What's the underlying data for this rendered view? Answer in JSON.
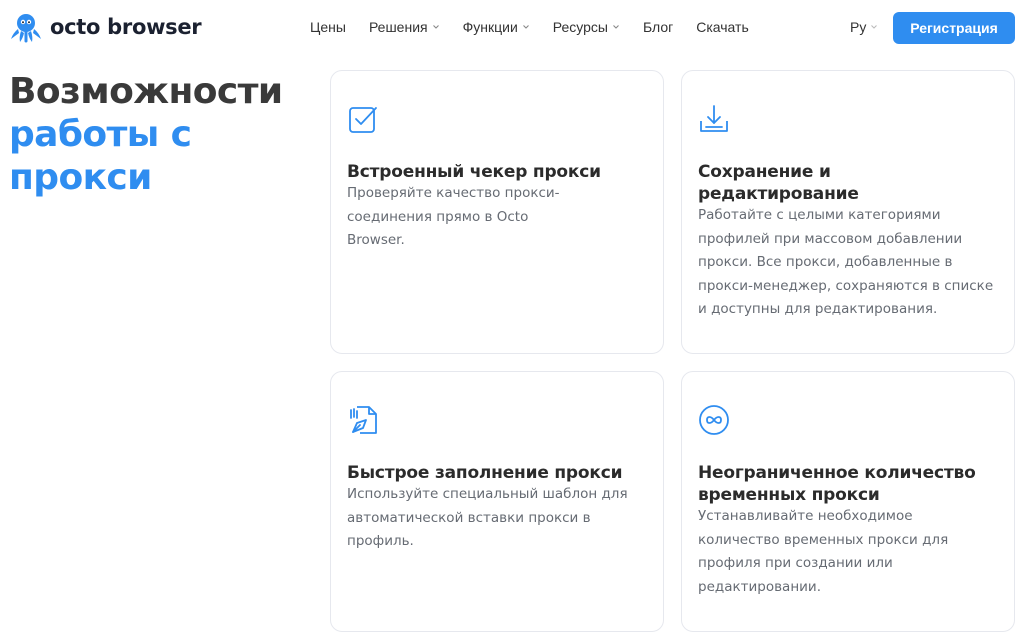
{
  "brand": {
    "name": "octo browser",
    "accent": "#2f8df0",
    "text_dark": "#1b2130"
  },
  "nav": {
    "items": [
      {
        "label": "Цены",
        "dropdown": false
      },
      {
        "label": "Решения",
        "dropdown": true
      },
      {
        "label": "Функции",
        "dropdown": true
      },
      {
        "label": "Ресурсы",
        "dropdown": true
      },
      {
        "label": "Блог",
        "dropdown": false
      },
      {
        "label": "Скачать",
        "dropdown": false
      }
    ],
    "language": "Ру",
    "register_label": "Регистрация"
  },
  "hero": {
    "line1": "Возможности",
    "line2": "работы с",
    "line3": "прокси"
  },
  "cards": [
    {
      "icon": "checkbox-icon",
      "title": "Встроенный чекер прокси",
      "text": "Проверяйте качество прокси-соединения прямо в Octo Browser."
    },
    {
      "icon": "download-icon",
      "title": "Сохранение и редактирование",
      "text": "Работайте с целыми категориями профилей при массовом добавлении прокси. Все прокси, добавленные в прокси-менеджер, сохраняются в списке и доступны для редактирования."
    },
    {
      "icon": "autofill-icon",
      "title": "Быстрое заполнение прокси",
      "text": "Используйте специальный шаблон для автоматической вставки прокси в профиль."
    },
    {
      "icon": "infinity-icon",
      "title": "Неограниченное количество временных прокси",
      "text": "Устанавливайте необходимое количество временных прокси для профиля при создании или редактировании."
    }
  ]
}
